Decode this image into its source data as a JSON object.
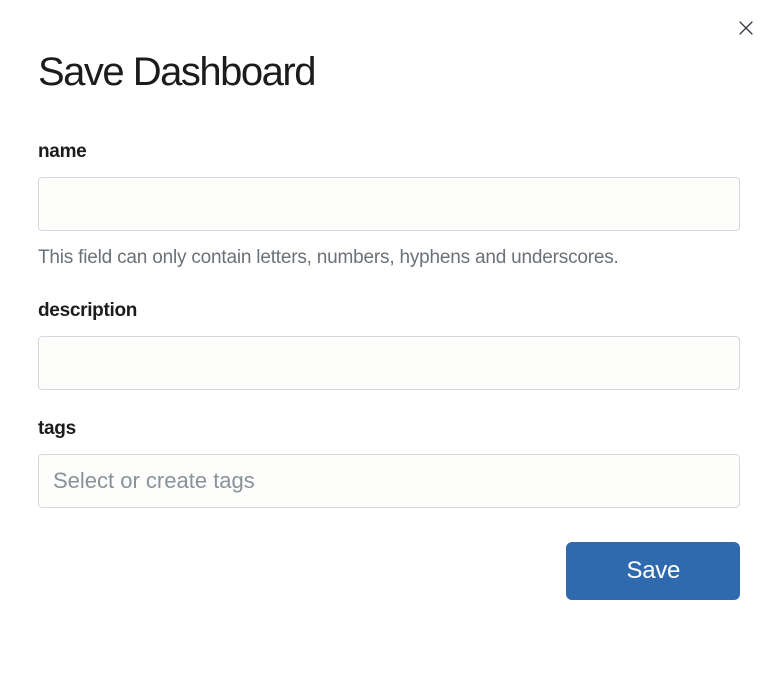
{
  "modal": {
    "title": "Save Dashboard",
    "close_label": "Close"
  },
  "form": {
    "name": {
      "label": "name",
      "value": "",
      "hint": "This field can only contain letters, numbers, hyphens and underscores."
    },
    "description": {
      "label": "description",
      "value": ""
    },
    "tags": {
      "label": "tags",
      "value": "",
      "placeholder": "Select or create tags"
    }
  },
  "buttons": {
    "save": "Save"
  }
}
